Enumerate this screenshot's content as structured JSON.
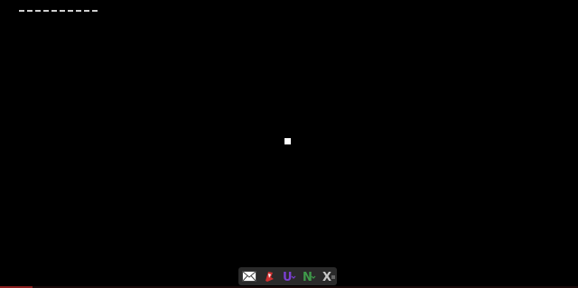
{
  "screen": {
    "background": "#000000"
  },
  "indicator": {
    "segments": 10,
    "color": "#cfcfcf"
  },
  "tray": {
    "items": [
      {
        "icon": "mail-icon"
      },
      {
        "icon": "red-app-icon"
      },
      {
        "icon": "u-app-icon",
        "glyph": "U"
      },
      {
        "icon": "n-app-icon",
        "glyph": "N"
      },
      {
        "icon": "x-app-icon",
        "glyph": "X"
      }
    ]
  },
  "colors": {
    "tray_bg": "#2a2a2a",
    "u_icon": "#7a3fd0",
    "n_icon": "#3f9a4a",
    "x_icon": "#c8c8c8",
    "red_icon": "#d03030"
  }
}
